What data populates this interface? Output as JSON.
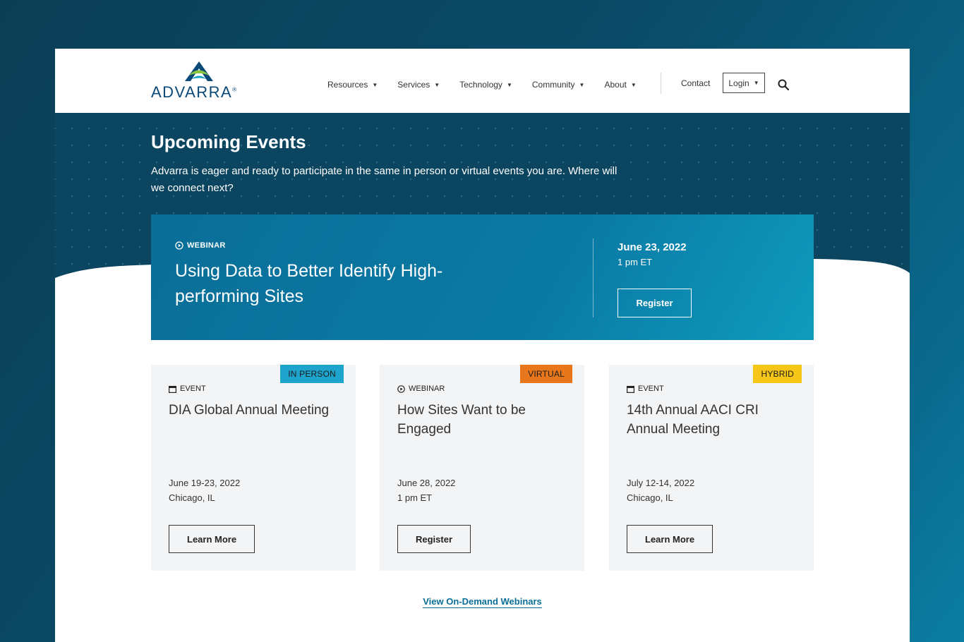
{
  "brand": {
    "name": "ADVARRA",
    "trademark": "®",
    "colors": {
      "navy": "#0b4a78",
      "green": "#8cc63f",
      "teal": "#12a3c1"
    }
  },
  "nav": {
    "items": [
      {
        "label": "Resources",
        "caret": "▼"
      },
      {
        "label": "Services",
        "caret": "▼"
      },
      {
        "label": "Technology",
        "caret": "▼"
      },
      {
        "label": "Community",
        "caret": "▼"
      },
      {
        "label": "About",
        "caret": "▼"
      }
    ],
    "contact": "Contact",
    "login": "Login",
    "login_caret": "▼",
    "search_icon": "search-icon"
  },
  "hero": {
    "title": "Upcoming Events",
    "subtitle": "Advarra is eager and ready to participate in the same in person or virtual events you are. Where will we connect next?"
  },
  "featured": {
    "type": "WEBINAR",
    "type_icon": "play-circle-icon",
    "title": "Using Data to Better Identify High-performing Sites",
    "date": "June 23, 2022",
    "time": "1 pm ET",
    "button": "Register"
  },
  "cards": [
    {
      "badge": "IN PERSON",
      "badge_color": "#1ea4cc",
      "type": "EVENT",
      "type_icon": "calendar-icon",
      "title": "DIA Global Annual Meeting",
      "date": "June 19-23, 2022",
      "detail": "Chicago, IL",
      "button": "Learn More"
    },
    {
      "badge": "VIRTUAL",
      "badge_color": "#e8771b",
      "type": "WEBINAR",
      "type_icon": "play-circle-icon",
      "title": "How Sites Want to be Engaged",
      "date": "June 28, 2022",
      "detail": "1 pm ET",
      "button": "Register"
    },
    {
      "badge": "HYBRID",
      "badge_color": "#f5c518",
      "type": "EVENT",
      "type_icon": "calendar-icon",
      "title": "14th Annual AACI CRI Annual Meeting",
      "date": "July 12-14, 2022",
      "detail": "Chicago, IL",
      "button": "Learn More"
    }
  ],
  "footer_link": "View On-Demand Webinars"
}
